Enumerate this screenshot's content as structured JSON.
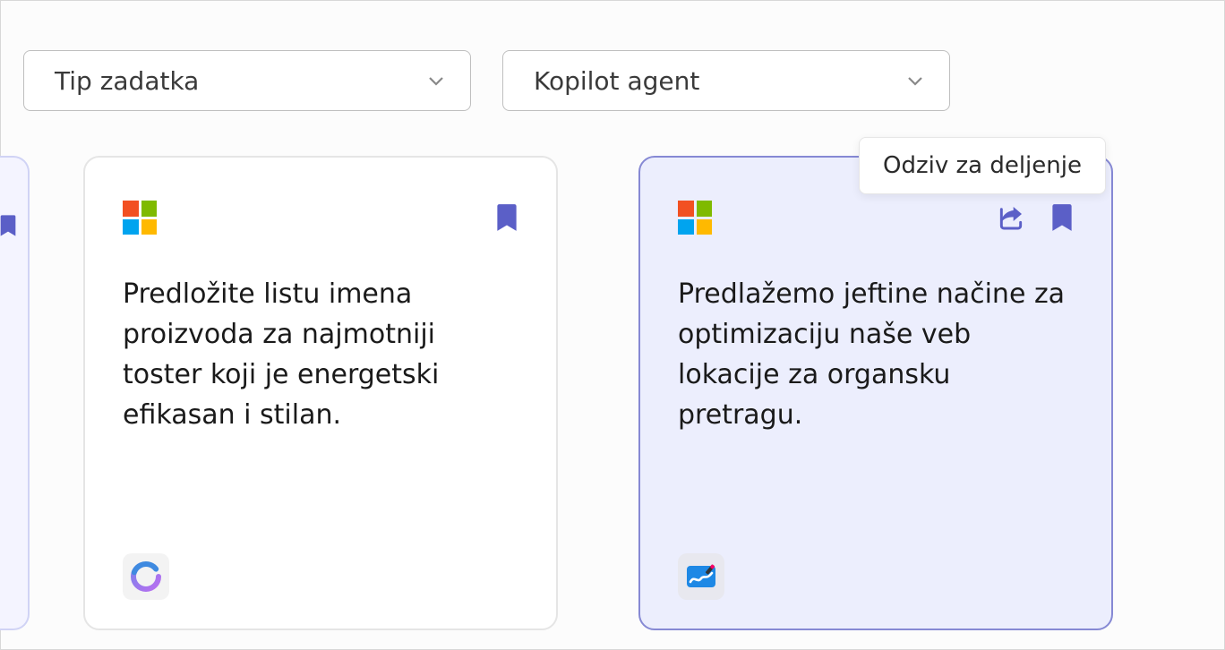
{
  "filters": {
    "task_type": "Tip zadatka",
    "copilot_agent": "Kopilot agent"
  },
  "tooltip": "Odziv za deljenje",
  "cards": [
    {
      "text": "Predložite listu imena proizvoda za najmotniji toster koji je energetski efikasan i stilan.",
      "app_icon": "loop"
    },
    {
      "text": "Predlažemo jeftine načine za optimizaciju naše veb lokacije za organsku pretragu.",
      "app_icon": "whiteboard"
    }
  ]
}
